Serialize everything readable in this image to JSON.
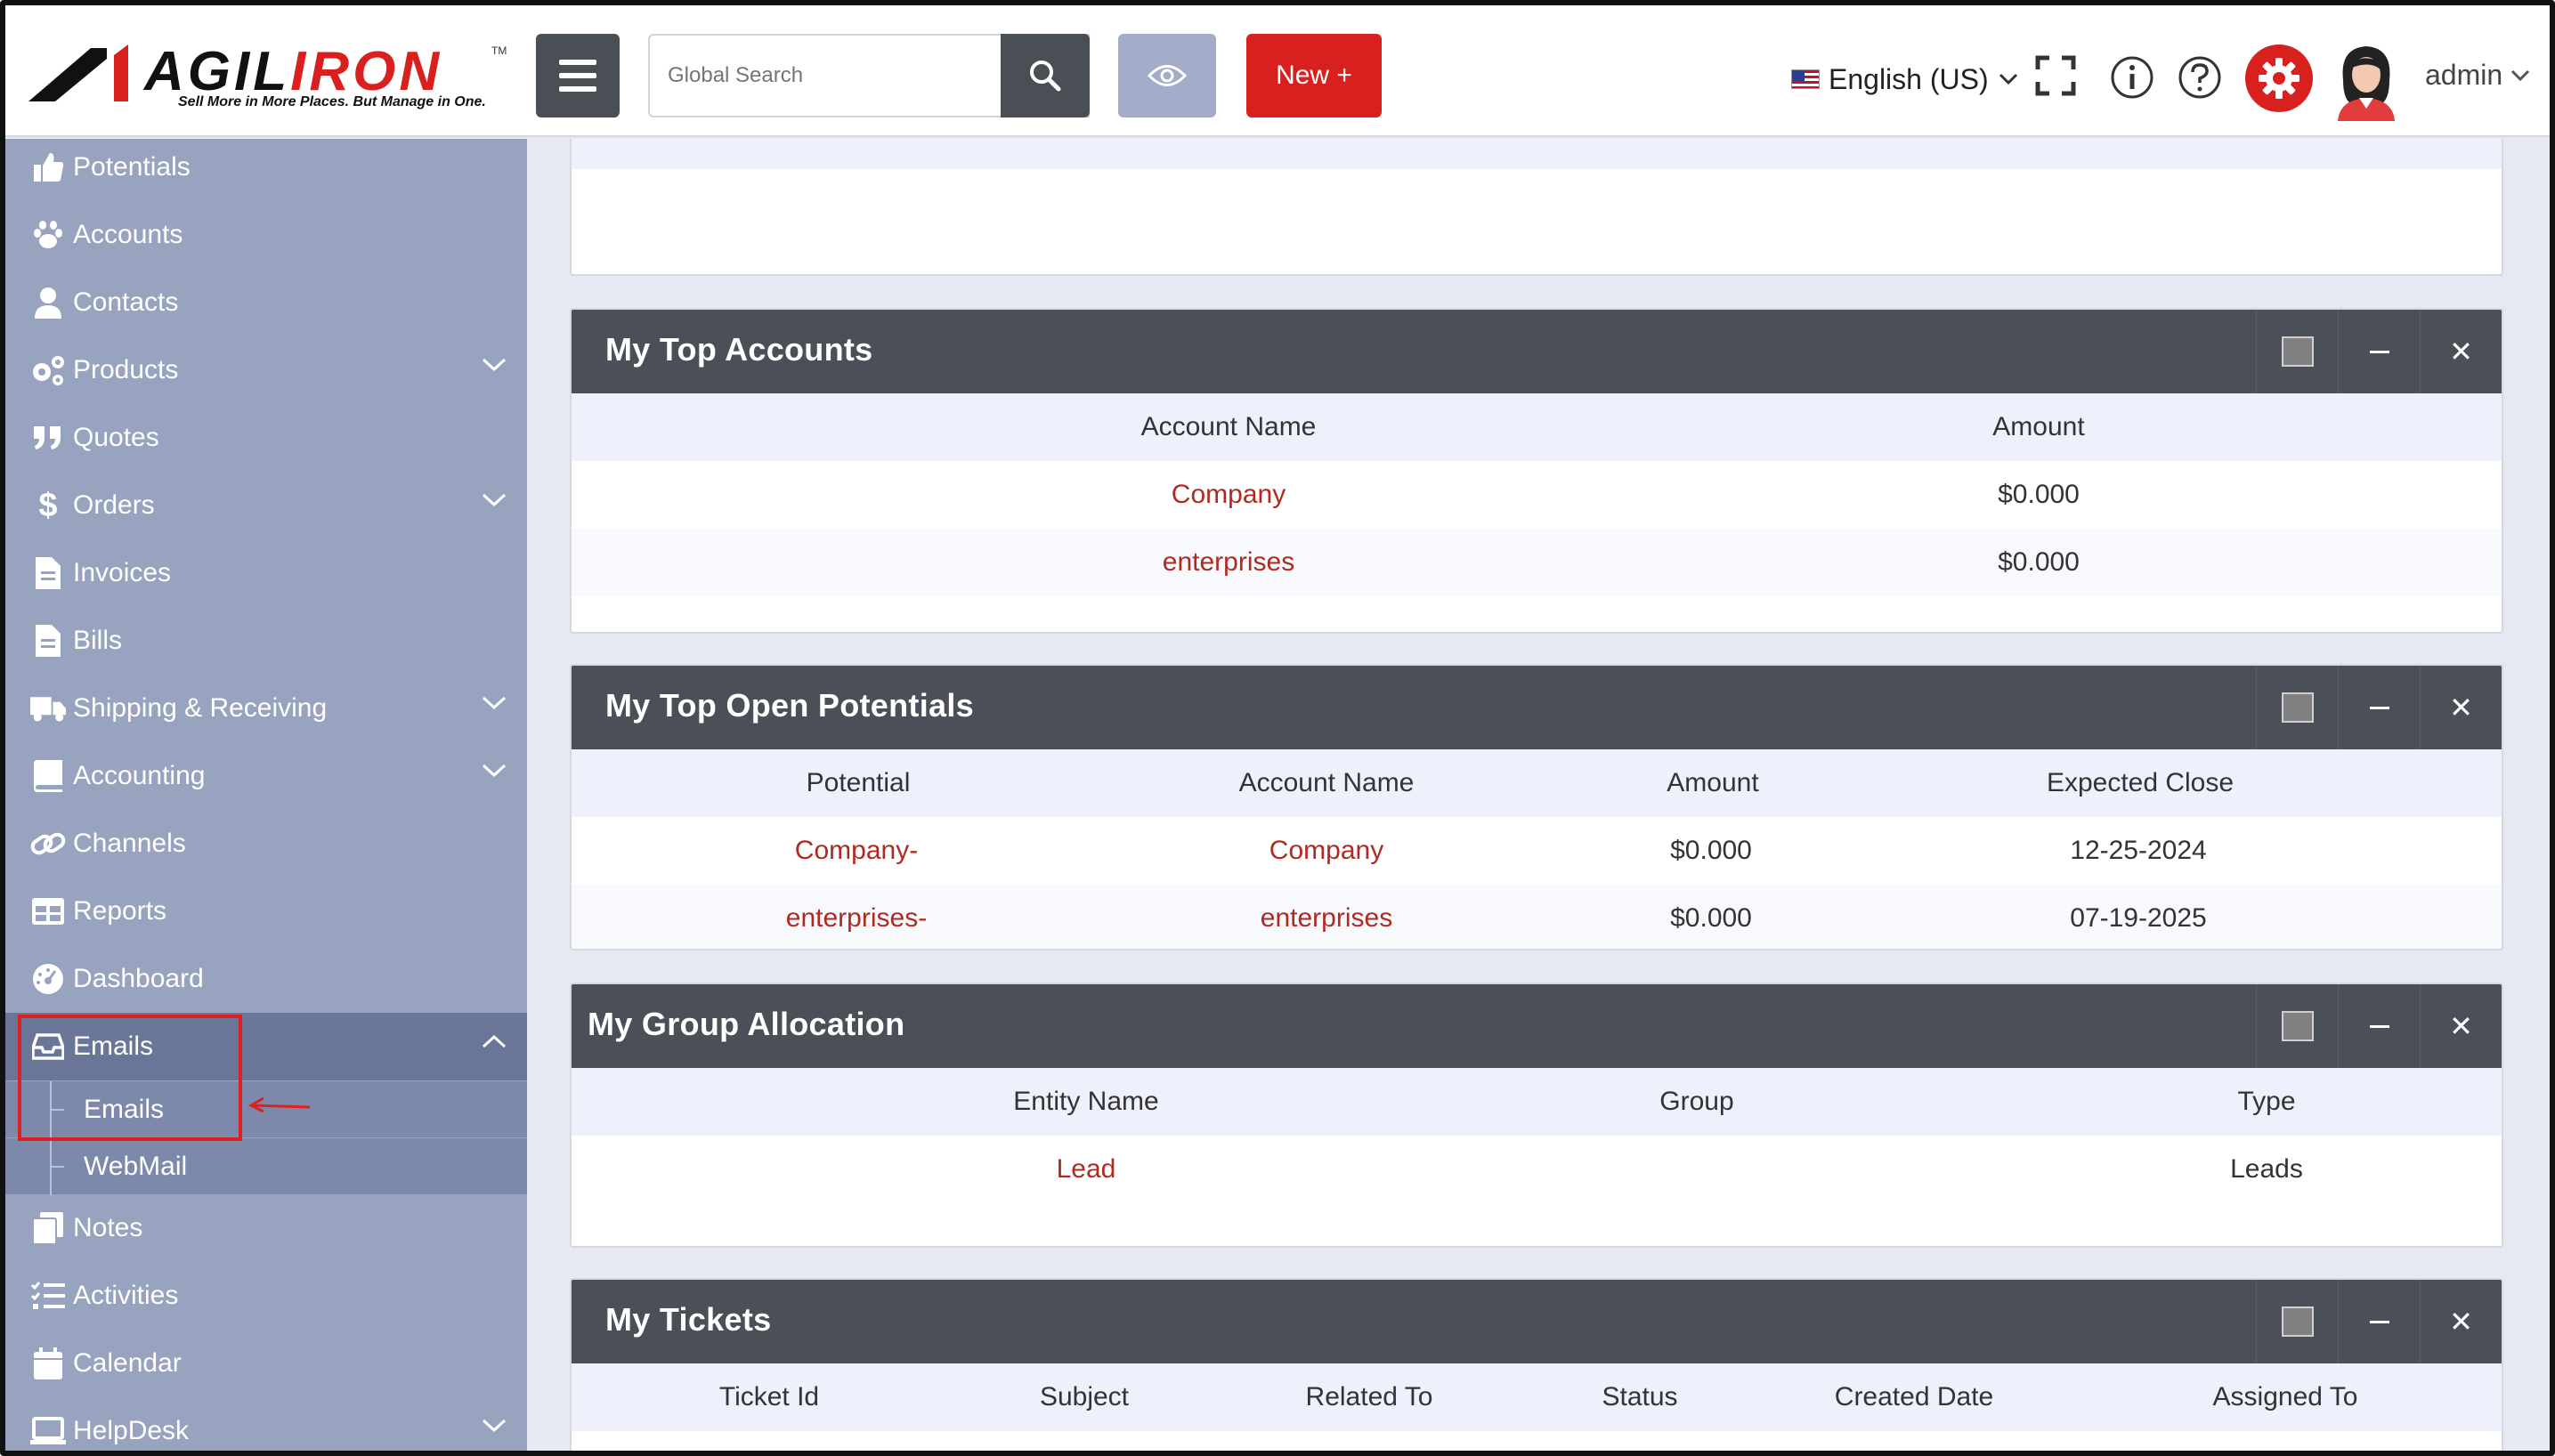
{
  "header": {
    "logo_main": "AGIL",
    "logo_accent": "IRON",
    "logo_tagline": "Sell More in More Places. But Manage in One.",
    "logo_tm": "TM",
    "search_placeholder": "Global Search",
    "new_button_label": "New +",
    "language": "English (US)",
    "user_name": "admin"
  },
  "sidebar": {
    "items": [
      {
        "label": "Potentials",
        "icon": "thumbs-up-icon"
      },
      {
        "label": "Accounts",
        "icon": "paw-icon"
      },
      {
        "label": "Contacts",
        "icon": "user-icon"
      },
      {
        "label": "Products",
        "icon": "gears-icon"
      },
      {
        "label": "Quotes",
        "icon": "quote-icon"
      },
      {
        "label": "Orders",
        "icon": "dollar-icon"
      },
      {
        "label": "Invoices",
        "icon": "file-icon"
      },
      {
        "label": "Bills",
        "icon": "file-icon"
      },
      {
        "label": "Shipping & Receiving",
        "icon": "truck-icon"
      },
      {
        "label": "Accounting",
        "icon": "book-icon"
      },
      {
        "label": "Channels",
        "icon": "link-icon"
      },
      {
        "label": "Reports",
        "icon": "table-icon"
      },
      {
        "label": "Dashboard",
        "icon": "gauge-icon"
      },
      {
        "label": "Emails",
        "icon": "inbox-icon"
      },
      {
        "label": "Notes",
        "icon": "notes-icon"
      },
      {
        "label": "Activities",
        "icon": "checklist-icon"
      },
      {
        "label": "Calendar",
        "icon": "calendar-icon"
      },
      {
        "label": "HelpDesk",
        "icon": "helpdesk-icon"
      }
    ],
    "email_subitems": [
      "Emails",
      "WebMail"
    ]
  },
  "panels": {
    "top_accounts": {
      "title": "My Top Accounts",
      "columns": [
        "Account Name",
        "Amount"
      ],
      "rows": [
        [
          "Company",
          "$0.000"
        ],
        [
          "enterprises",
          "$0.000"
        ]
      ]
    },
    "top_potentials": {
      "title": "My Top Open Potentials",
      "columns": [
        "Potential",
        "Account Name",
        "Amount",
        "Expected Close"
      ],
      "rows": [
        [
          "Company-",
          "Company",
          "$0.000",
          "12-25-2024"
        ],
        [
          "enterprises-",
          "enterprises",
          "$0.000",
          "07-19-2025"
        ]
      ]
    },
    "group_allocation": {
      "title": "My Group Allocation",
      "columns": [
        "Entity Name",
        "Group",
        "Type"
      ],
      "rows": [
        [
          "Lead",
          "",
          "Leads"
        ]
      ]
    },
    "tickets": {
      "title": "My Tickets",
      "columns": [
        "Ticket Id",
        "Subject",
        "Related To",
        "Status",
        "Created Date",
        "Assigned To"
      ]
    }
  },
  "colors": {
    "brand_red": "#d8201f",
    "sidebar_bg": "#98a3bf",
    "panel_header": "#4b4f57",
    "link": "#b02a22"
  }
}
